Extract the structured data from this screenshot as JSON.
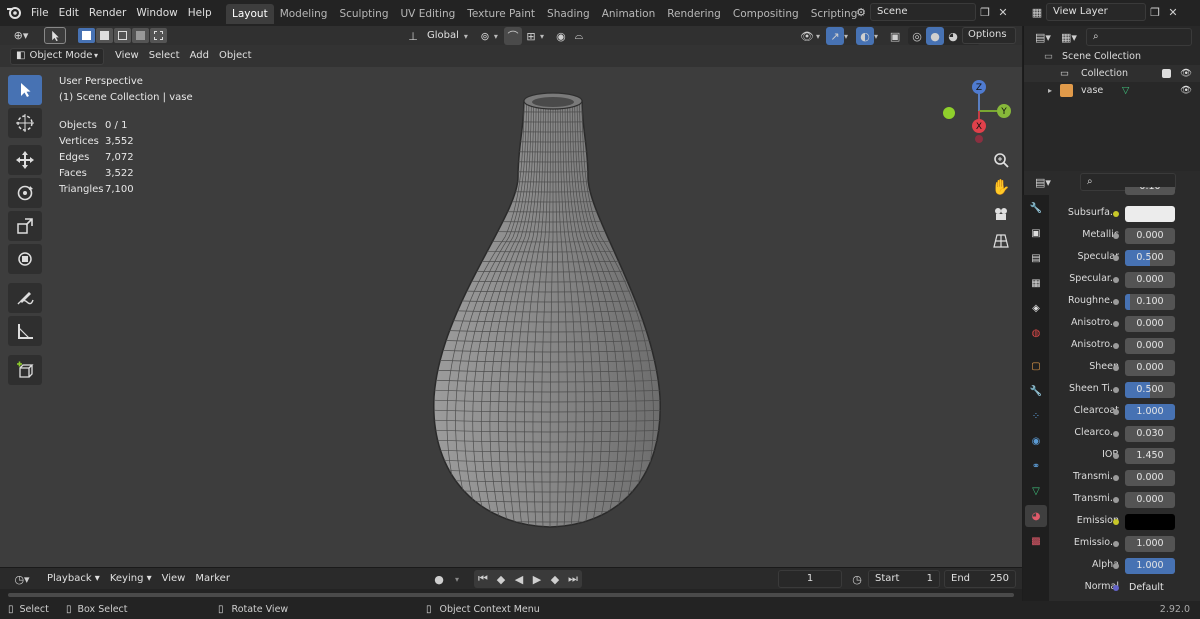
{
  "menu": {
    "file": "File",
    "edit": "Edit",
    "render": "Render",
    "window": "Window",
    "help": "Help"
  },
  "workspaces": [
    "Layout",
    "Modeling",
    "Sculpting",
    "UV Editing",
    "Texture Paint",
    "Shading",
    "Animation",
    "Rendering",
    "Compositing",
    "Scripting"
  ],
  "active_workspace": "Layout",
  "scene": {
    "name": "Scene"
  },
  "view_layer": {
    "name": "View Layer"
  },
  "viewport_header": {
    "mode": "Object Mode",
    "view": "View",
    "select": "Select",
    "add": "Add",
    "object": "Object",
    "orientation": "Global",
    "options": "Options"
  },
  "overlay_text": {
    "perspective": "User Perspective",
    "collection_line": "(1) Scene Collection | vase",
    "stats": [
      {
        "label": "Objects",
        "value": "0 / 1"
      },
      {
        "label": "Vertices",
        "value": "3,552"
      },
      {
        "label": "Edges",
        "value": "7,072"
      },
      {
        "label": "Faces",
        "value": "3,522"
      },
      {
        "label": "Triangles",
        "value": "7,100"
      }
    ]
  },
  "gizmo": {
    "z": "Z",
    "y": "Y",
    "x": "X"
  },
  "timeline": {
    "playback": "Playback",
    "keying": "Keying",
    "view": "View",
    "marker": "Marker",
    "current_frame": "1",
    "start_label": "Start",
    "start": "1",
    "end_label": "End",
    "end": "250"
  },
  "statusbar": {
    "select": "Select",
    "box_select": "Box Select",
    "rotate_view": "Rotate View",
    "context_menu": "Object Context Menu",
    "version": "2.92.0"
  },
  "outliner": {
    "scene_collection": "Scene Collection",
    "collection": "Collection",
    "object": "vase"
  },
  "properties": {
    "rows": [
      {
        "label": "Subsurfa...",
        "kind": "color",
        "color": "#ececec",
        "dot": "yellow"
      },
      {
        "label": "Metallic",
        "kind": "num",
        "value": "0.000",
        "fill": 0
      },
      {
        "label": "Specular",
        "kind": "num",
        "value": "0.500",
        "fill": 0.5
      },
      {
        "label": "Specular...",
        "kind": "num",
        "value": "0.000",
        "fill": 0
      },
      {
        "label": "Roughne...",
        "kind": "num",
        "value": "0.100",
        "fill": 0.1
      },
      {
        "label": "Anisotro...",
        "kind": "num",
        "value": "0.000",
        "fill": 0
      },
      {
        "label": "Anisotro...",
        "kind": "num",
        "value": "0.000",
        "fill": 0
      },
      {
        "label": "Sheen",
        "kind": "num",
        "value": "0.000",
        "fill": 0
      },
      {
        "label": "Sheen Ti...",
        "kind": "num",
        "value": "0.500",
        "fill": 0.5
      },
      {
        "label": "Clearcoat",
        "kind": "num",
        "value": "1.000",
        "fill": 1
      },
      {
        "label": "Clearco...",
        "kind": "num",
        "value": "0.030",
        "fill": 0
      },
      {
        "label": "IOR",
        "kind": "num",
        "value": "1.450",
        "fill": 0
      },
      {
        "label": "Transmi...",
        "kind": "num",
        "value": "0.000",
        "fill": 0
      },
      {
        "label": "Transmi...",
        "kind": "num",
        "value": "0.000",
        "fill": 0
      },
      {
        "label": "Emission",
        "kind": "color",
        "color": "#000000",
        "dot": "yellow"
      },
      {
        "label": "Emissio...",
        "kind": "num",
        "value": "1.000",
        "fill": 0
      },
      {
        "label": "Alpha",
        "kind": "num",
        "value": "1.000",
        "fill": 1
      },
      {
        "label": "Normal",
        "kind": "text",
        "value": "Default",
        "dot": "purple"
      }
    ],
    "partial_top": "0.10"
  },
  "colors": {
    "accent": "#4772b3",
    "viewport_bg": "#3d3d3d"
  }
}
